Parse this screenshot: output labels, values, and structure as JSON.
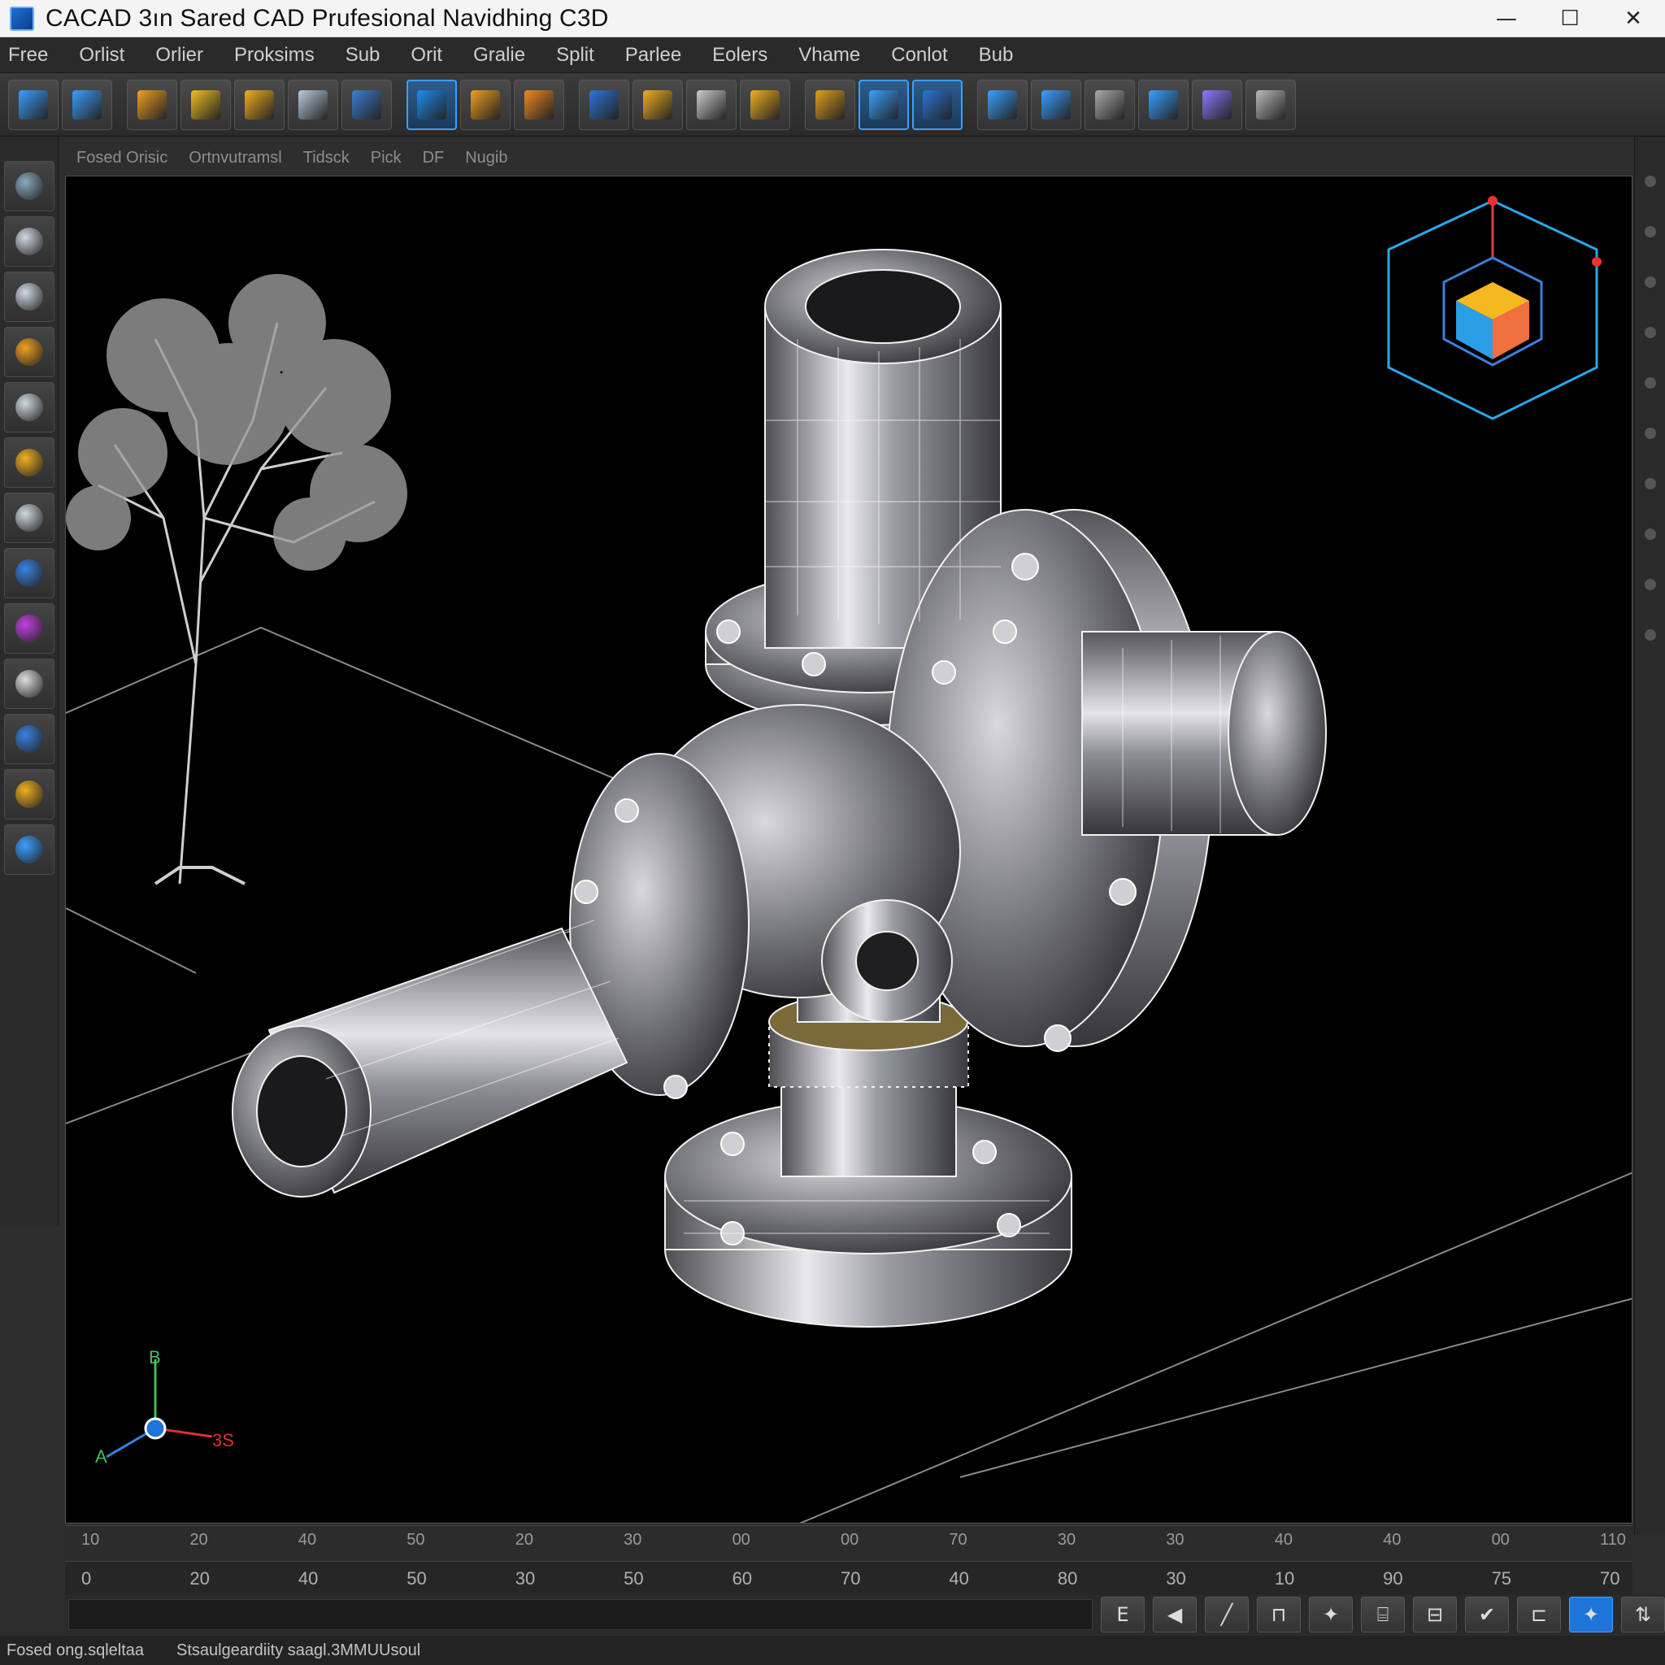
{
  "window": {
    "title": "CACAD 3ın Sared CAD Prufesional Navidhing C3D",
    "minimize": "—",
    "maximize": "☐",
    "close": "✕"
  },
  "menu": [
    "Free",
    "Orlist",
    "Orlier",
    "Proksims",
    "Sub",
    "Orit",
    "Gralie",
    "Split",
    "Parlee",
    "Eolers",
    "Vhame",
    "Conlot",
    "Bub"
  ],
  "toolbar": {
    "tools": [
      {
        "icon": "select-icon",
        "color": "#3aa0ff"
      },
      {
        "icon": "pick-icon",
        "color": "#3aa0ff"
      },
      {
        "icon": "move-icon",
        "color": "#f0a020"
      },
      {
        "icon": "pencil-icon",
        "color": "#f0c020"
      },
      {
        "icon": "paint-icon",
        "color": "#f0b020"
      },
      {
        "icon": "hammer-icon",
        "color": "#bcd"
      },
      {
        "icon": "panel-icon",
        "color": "#3a7fd0"
      },
      {
        "icon": "layout-icon",
        "color": "#1c8ef0"
      },
      {
        "icon": "diamond-icon",
        "color": "#f0a020"
      },
      {
        "icon": "orbit-icon",
        "color": "#f08a20"
      },
      {
        "icon": "shape-icon",
        "color": "#2b76d6"
      },
      {
        "icon": "layers-icon",
        "color": "#f0b020"
      },
      {
        "icon": "download-icon",
        "color": "#ccc"
      },
      {
        "icon": "chart-icon",
        "color": "#f0b020"
      },
      {
        "icon": "hat-icon",
        "color": "#e0a020"
      },
      {
        "icon": "cube-icon",
        "color": "#3aa0ff"
      },
      {
        "icon": "grid-icon",
        "color": "#2b76d6"
      },
      {
        "icon": "wing-icon",
        "color": "#3aa0ff"
      },
      {
        "icon": "fish-icon",
        "color": "#3aa0ff"
      },
      {
        "icon": "cloud-icon",
        "color": "#aaa"
      },
      {
        "icon": "monitor-icon",
        "color": "#3aa0ff"
      },
      {
        "icon": "snowflake-icon",
        "color": "#8a7aff"
      },
      {
        "icon": "gear-icon",
        "color": "#bbb"
      }
    ],
    "active": [
      7,
      15,
      16
    ]
  },
  "lefttools": [
    {
      "icon": "gear-icon",
      "color": "#8ab"
    },
    {
      "icon": "hook-icon",
      "color": "#cfd8e0"
    },
    {
      "icon": "check-curve-icon",
      "color": "#cfd8e0"
    },
    {
      "icon": "eraser-icon",
      "color": "#f0a020"
    },
    {
      "icon": "lasso-icon",
      "color": "#cfd8e0"
    },
    {
      "icon": "check-icon",
      "color": "#f0b020"
    },
    {
      "icon": "cube-select-icon",
      "color": "#cfd8e0"
    },
    {
      "icon": "compass-icon",
      "color": "#3a80e0"
    },
    {
      "icon": "brush-icon",
      "color": "#c040e0"
    },
    {
      "icon": "sphere-icon",
      "color": "#ddd"
    },
    {
      "icon": "bucket-icon",
      "color": "#3a80e0"
    },
    {
      "icon": "frame-icon",
      "color": "#f0b020"
    },
    {
      "icon": "tape-icon",
      "color": "#3aa0ff"
    }
  ],
  "viewport": {
    "tabs": [
      "Fosed Orisic",
      "Ortnvutramsl",
      "Tidsck",
      "Pick",
      "DF",
      "Nugib"
    ],
    "axis_labels": {
      "up": "B",
      "right": "3S",
      "left": "A"
    }
  },
  "ruler_top": [
    "10",
    "20",
    "40",
    "50",
    "20",
    "30",
    "00",
    "00",
    "70",
    "30",
    "30",
    "40",
    "40",
    "00",
    "110"
  ],
  "ruler_bottom": [
    "0",
    "20",
    "40",
    "50",
    "30",
    "50",
    "60",
    "70",
    "40",
    "80",
    "30",
    "10",
    "90",
    "75",
    "70"
  ],
  "commandbar": {
    "buttons": [
      "E",
      "◀",
      "╱",
      "⊓",
      "✦",
      "⌸",
      "⊟",
      "✔",
      "⊏",
      "✦",
      "⇅"
    ]
  },
  "status": {
    "left": "Fosed ong.sqleltaa",
    "right": "Stsaulgeardiity saagl.3MMUUsoul"
  },
  "colors": {
    "accent": "#1e74d8",
    "background": "#000000",
    "wireframe": "#e8e8e8",
    "gold": "#c7a348"
  }
}
